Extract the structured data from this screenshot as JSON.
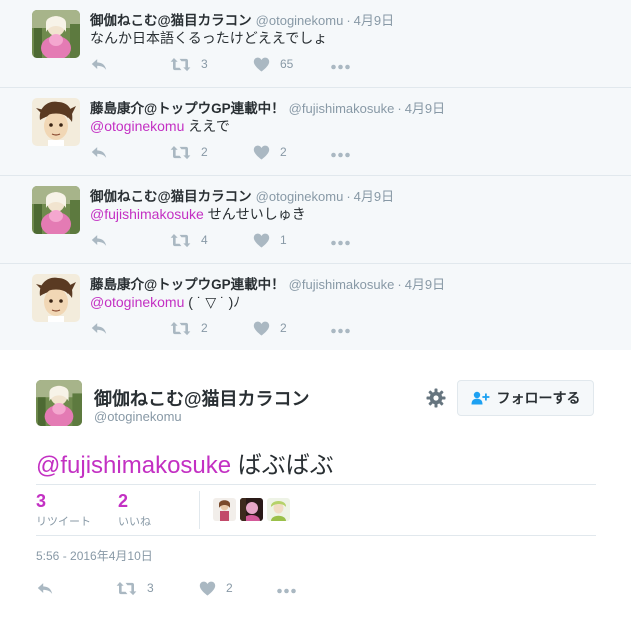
{
  "replies": [
    {
      "name": "御伽ねこむ@猫目カラコン",
      "screen_name": "@otoginekomu",
      "time": "4月9日",
      "mention": "",
      "text": "なんか日本語くるったけどええでしょ",
      "retweets": "3",
      "likes": "65"
    },
    {
      "name": "藤島康介@トップウGP連載中！",
      "screen_name": "@fujishimakosuke",
      "time": "4月9日",
      "mention": "@otoginekomu",
      "text": " ええで",
      "retweets": "2",
      "likes": "2"
    },
    {
      "name": "御伽ねこむ@猫目カラコン",
      "screen_name": "@otoginekomu",
      "time": "4月9日",
      "mention": "@fujishimakosuke",
      "text": " せんせいしゅき",
      "retweets": "4",
      "likes": "1"
    },
    {
      "name": "藤島康介@トップウGP連載中！",
      "screen_name": "@fujishimakosuke",
      "time": "4月9日",
      "mention": "@otoginekomu",
      "text": " ( ˙ ▽ ˙ )ﾉ",
      "retweets": "2",
      "likes": "2"
    }
  ],
  "main_tweet": {
    "name": "御伽ねこむ@猫目カラコン",
    "screen_name": "@otoginekomu",
    "follow_label": "フォローする",
    "mention": "@fujishimakosuke",
    "text": " ばぶばぶ",
    "retweet_count": "3",
    "retweet_label": "リツイート",
    "like_count": "2",
    "like_label": "いいね",
    "timestamp": "5:56 - 2016年4月10日",
    "action_retweets": "3",
    "action_likes": "2"
  },
  "colors": {
    "accent": "#c330c3",
    "muted": "#8899a6",
    "icon": "#aab8c2",
    "reply_bg": "#f5f8fa"
  },
  "icons": [
    "reply-icon",
    "retweet-icon",
    "heart-icon",
    "more-icon",
    "gear-icon",
    "follow-person-icon"
  ]
}
